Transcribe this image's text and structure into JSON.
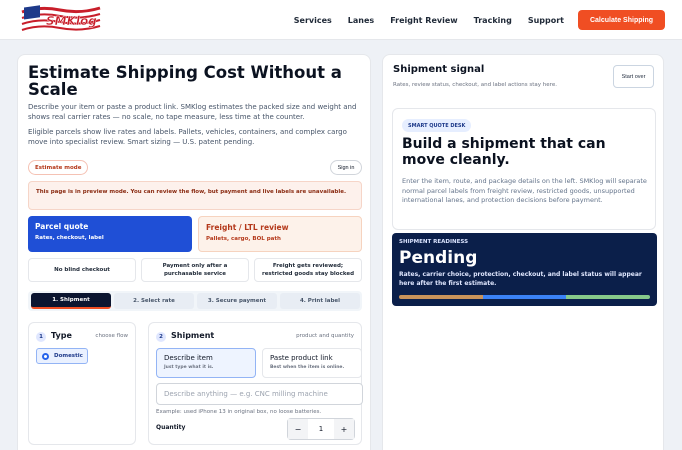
{
  "header": {
    "logo_text": "SMKlog",
    "nav": [
      "Services",
      "Lanes",
      "Freight Review",
      "Tracking",
      "Support"
    ],
    "cta": "Calculate Shipping"
  },
  "main": {
    "title": "Estimate Shipping Cost Without a Scale",
    "description1": "Describe your item or paste a product link. SMKlog estimates the packed size and weight and shows real carrier rates — no scale, no tape measure, less time at the counter.",
    "description2": "Eligible parcels show live rates and labels. Pallets, vehicles, containers, and complex cargo move into specialist review. Smart sizing — U.S. patent pending.",
    "mode_badge": "Estimate mode",
    "sign_in": "Sign in",
    "preview_notice": "This page is in preview mode. You can review the flow, but payment and live labels are unavailable.",
    "quote_options": [
      {
        "title": "Parcel quote",
        "subtitle": "Rates, checkout, label"
      },
      {
        "title": "Freight / LTL review",
        "subtitle": "Pallets, cargo, BOL path"
      }
    ],
    "features": [
      "No blind checkout",
      "Payment only after a purchasable service",
      "Freight gets reviewed; restricted goods stay blocked"
    ],
    "steps": [
      "1. Shipment",
      "2. Select rate",
      "3. Secure payment",
      "4. Print label"
    ],
    "type_section": {
      "number": "1",
      "title": "Type",
      "hint": "choose flow",
      "option": "Domestic"
    },
    "shipment_section": {
      "number": "2",
      "title": "Shipment",
      "hint": "product and quantity",
      "options": [
        {
          "title": "Describe item",
          "subtitle": "Just type what it is."
        },
        {
          "title": "Paste product link",
          "subtitle": "Best when the item is online."
        }
      ],
      "input_placeholder": "Describe anything — e.g. CNC milling machine",
      "example": "Example: used iPhone 13 in original box, no loose batteries.",
      "quantity_label": "Quantity",
      "quantity_value": "1",
      "minus": "−",
      "plus": "+"
    }
  },
  "signal": {
    "title": "Shipment signal",
    "subtitle": "Rates, review status, checkout, and label actions stay here.",
    "start_over": "Start over",
    "desk_badge": "SMART QUOTE DESK",
    "heading": "Build a shipment that can move cleanly.",
    "body": "Enter the item, route, and package details on the left. SMKlog will separate normal parcel labels from freight review, restricted goods, unsupported international lanes, and protection decisions before payment.",
    "readiness_label": "SHIPMENT READINESS",
    "readiness_status": "Pending",
    "readiness_body": "Rates, carrier choice, protection, checkout, and label status will appear here after the first estimate."
  },
  "colors": {
    "accent": "#f04e23",
    "primary": "#1f4fd6",
    "navy": "#0b1f4a",
    "bar": [
      "#c9935a",
      "#3b82f6",
      "#86c98a"
    ]
  }
}
